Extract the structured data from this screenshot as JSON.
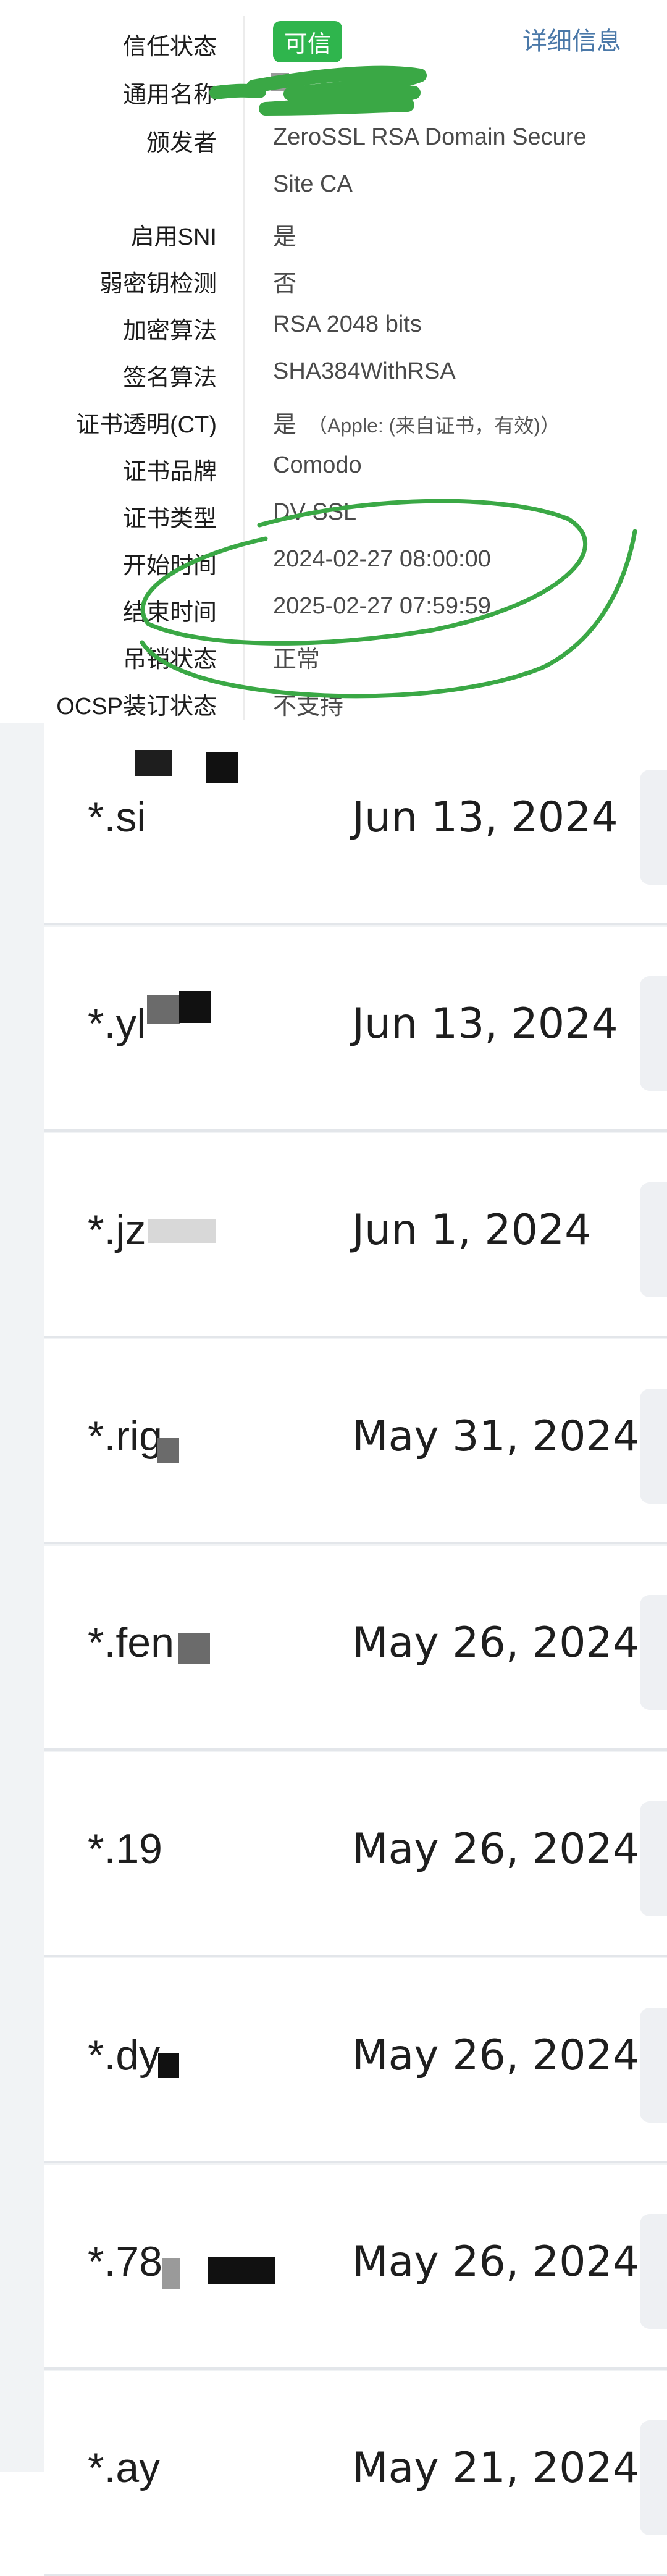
{
  "certificate": {
    "trust_status": {
      "label": "信任状态",
      "badge": "可信"
    },
    "details_link": "详细信息",
    "common_name": {
      "label": "通用名称"
    },
    "issuer": {
      "label": "颁发者",
      "value": "ZeroSSL RSA Domain Secure Site CA"
    },
    "sni": {
      "label": "启用SNI",
      "value": "是"
    },
    "weak_key": {
      "label": "弱密钥检测",
      "value": "否"
    },
    "encryption": {
      "label": "加密算法",
      "value": "RSA 2048 bits"
    },
    "signature": {
      "label": "签名算法",
      "value": "SHA384WithRSA"
    },
    "ct": {
      "label": "证书透明(CT)",
      "value": "是",
      "note": "（Apple: (来自证书，有效)）"
    },
    "brand": {
      "label": "证书品牌",
      "value": "Comodo"
    },
    "type": {
      "label": "证书类型",
      "value": "DV SSL"
    },
    "start": {
      "label": "开始时间",
      "value": "2024-02-27 08:00:00"
    },
    "end": {
      "label": "结束时间",
      "value": "2025-02-27 07:59:59"
    },
    "revocation": {
      "label": "吊销状态",
      "value": "正常"
    },
    "ocsp": {
      "label": "OCSP装订状态",
      "value": "不支持"
    },
    "colors": {
      "badge": "#2fb54d",
      "link": "#4a78a8",
      "scribble": "#3aa845"
    }
  },
  "list": {
    "items": [
      {
        "domain": "*.si",
        "date": "Jun 13, 2024"
      },
      {
        "domain": "*.yl",
        "date": "Jun 13, 2024"
      },
      {
        "domain": "*.jz",
        "date": "Jun 1, 2024"
      },
      {
        "domain": "*.rig",
        "date": "May 31, 2024"
      },
      {
        "domain": "*.fen",
        "date": "May 26, 2024"
      },
      {
        "domain": "*.19",
        "date": "May 26, 2024"
      },
      {
        "domain": "*.dy",
        "date": "May 26, 2024"
      },
      {
        "domain": "*.78",
        "date": "May 26, 2024"
      },
      {
        "domain": "*.ay",
        "date": "May 21, 2024"
      }
    ]
  }
}
